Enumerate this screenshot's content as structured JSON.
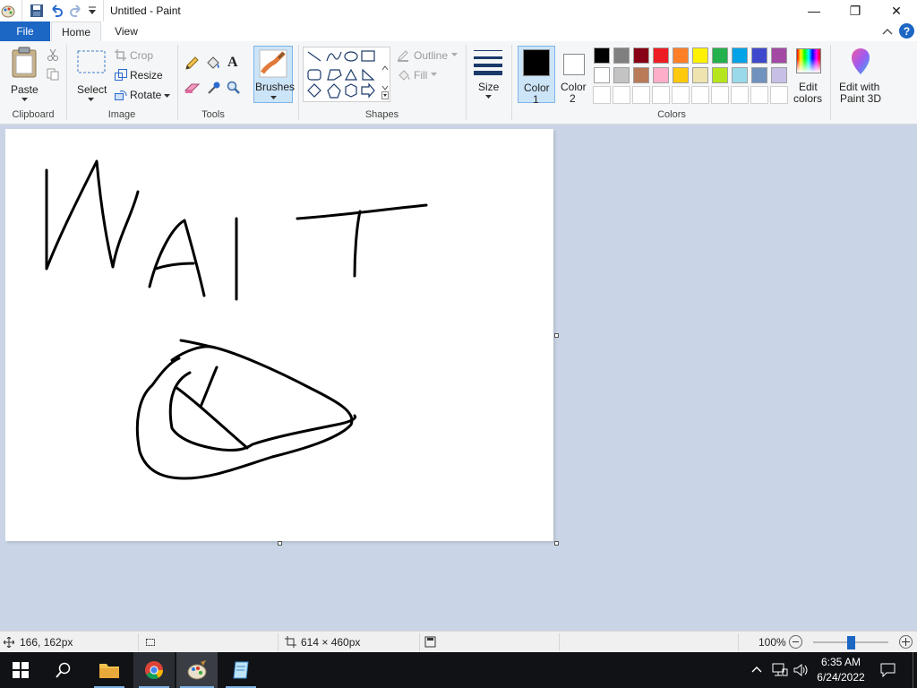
{
  "window": {
    "title": "Untitled - Paint",
    "minimize_label": "—",
    "restore_label": "❐",
    "close_label": "✕"
  },
  "tabs": [
    {
      "label": "File"
    },
    {
      "label": "Home"
    },
    {
      "label": "View"
    }
  ],
  "help_label": "?",
  "ribbon": {
    "clipboard": {
      "label": "Clipboard",
      "paste": "Paste"
    },
    "image": {
      "label": "Image",
      "select": "Select",
      "crop": "Crop",
      "resize": "Resize",
      "rotate": "Rotate"
    },
    "tools": {
      "label": "Tools"
    },
    "brushes": {
      "label": "Brushes"
    },
    "shapes": {
      "label": "Shapes",
      "outline": "Outline",
      "fill": "Fill"
    },
    "size": {
      "label": "Size"
    },
    "colors": {
      "label": "Colors",
      "color1": {
        "line1": "Color",
        "line2": "1",
        "value": "#000000"
      },
      "color2": {
        "line1": "Color",
        "line2": "2",
        "value": "#ffffff"
      },
      "edit_colors": {
        "line1": "Edit",
        "line2": "colors"
      },
      "palette_row1": [
        "#000000",
        "#7f7f7f",
        "#880015",
        "#ed1c24",
        "#ff7f27",
        "#fff200",
        "#22b14c",
        "#00a2e8",
        "#3f48cc",
        "#a349a4"
      ],
      "palette_row2": [
        "#ffffff",
        "#c3c3c3",
        "#b97a57",
        "#ffaec9",
        "#ffc90e",
        "#efe4b0",
        "#b5e61d",
        "#99d9ea",
        "#7092be",
        "#c8bfe7"
      ]
    },
    "paint3d": {
      "line1": "Edit with",
      "line2": "Paint 3D"
    }
  },
  "status": {
    "cursor_pos": "166, 162px",
    "canvas_size": "614 × 460px",
    "zoom": "100%",
    "zoom_fraction": 0.5
  },
  "taskbar": {
    "time": "6:35 AM",
    "date": "6/24/2022"
  }
}
